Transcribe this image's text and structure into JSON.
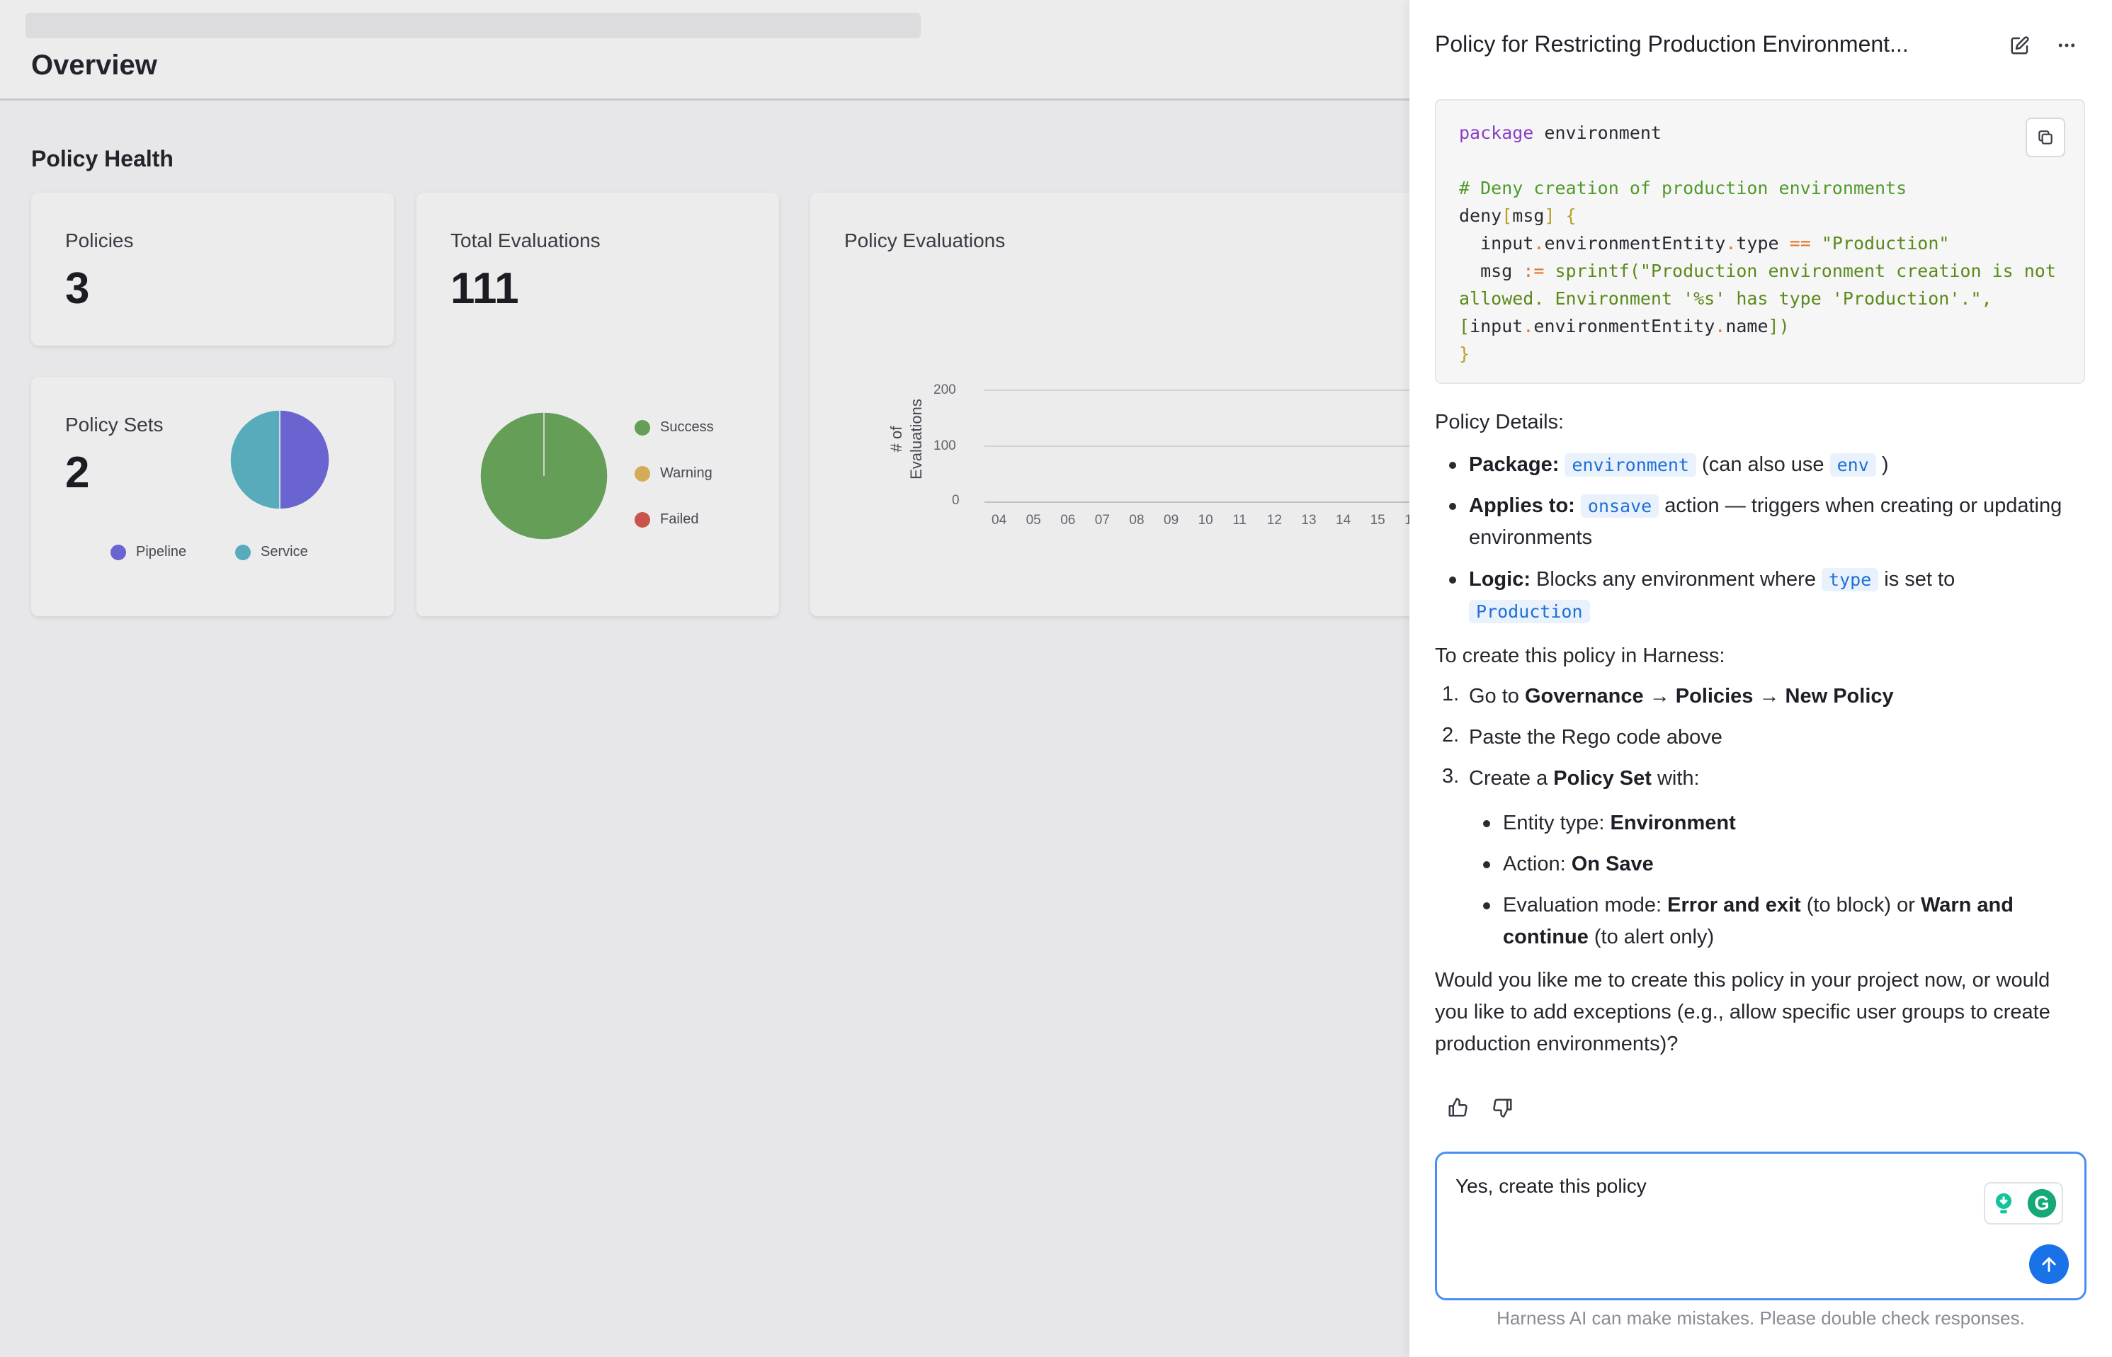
{
  "dashboard": {
    "title": "Overview",
    "section_title": "Policy Health",
    "policies": {
      "label": "Policies",
      "value": "3"
    },
    "policy_sets": {
      "label": "Policy Sets",
      "value": "2",
      "legend": [
        {
          "label": "Pipeline",
          "color": "#6f6ae0"
        },
        {
          "label": "Service",
          "color": "#5cb8c9"
        }
      ]
    },
    "total_evaluations": {
      "label": "Total Evaluations",
      "value": "111",
      "legend": [
        {
          "label": "Success",
          "color": "#6aaa5b"
        },
        {
          "label": "Warning",
          "color": "#e5b85a"
        },
        {
          "label": "Failed",
          "color": "#d9584e"
        }
      ]
    },
    "policy_evaluations": {
      "label": "Policy Evaluations",
      "y_axis_title_line1": "# of",
      "y_axis_title_line2": "Evaluations",
      "y_ticks": [
        "200",
        "100",
        "0"
      ],
      "x_ticks": [
        "04",
        "05",
        "06",
        "07",
        "08",
        "09",
        "10",
        "11",
        "12",
        "13",
        "14",
        "15",
        "1"
      ]
    }
  },
  "chart_data": [
    {
      "type": "pie",
      "title": "Policy Sets",
      "categories": [
        "Pipeline",
        "Service"
      ],
      "values": [
        1,
        1
      ],
      "colors": [
        "#6f6ae0",
        "#5cb8c9"
      ]
    },
    {
      "type": "pie",
      "title": "Total Evaluations",
      "categories": [
        "Success",
        "Warning",
        "Failed"
      ],
      "values": [
        111,
        0,
        0
      ],
      "colors": [
        "#6aaa5b",
        "#e5b85a",
        "#d9584e"
      ]
    }
  ],
  "panel": {
    "title": "Policy for Restricting Production Environment...",
    "icons": {
      "edit": "edit-icon",
      "more": "more-icon",
      "copy": "copy-icon",
      "thumbs_up": "thumbs-up-icon",
      "thumbs_down": "thumbs-down-icon",
      "send": "send-icon"
    },
    "code": {
      "kw_package": "package",
      "pkg_name": " environment",
      "comment": "# Deny creation of production environments",
      "deny": "deny",
      "lbr": "[",
      "msg": "msg",
      "rbr": "]",
      "lbrace": " {",
      "l3_indent": "  ",
      "l3_input": "input",
      "dot": ".",
      "l3_entity": "environmentEntity",
      "l3_type": "type",
      "eqeq": " == ",
      "l3_str": "\"Production\"",
      "l4_msg": "  msg ",
      "assign": ":= ",
      "sprintf": "sprintf(",
      "l4_str1": "\"Production environment creation is not",
      "l5_str2": "allowed. Environment '%s' has type 'Production'.\"",
      "comma": ",",
      "l6_lbr": "[",
      "l6_input": "input",
      "l6_entity": "environmentEntity",
      "l6_name": "name",
      "l6_close": "])",
      "rbrace": "}"
    },
    "details_heading": "Policy Details:",
    "details": [
      {
        "key": "Package:",
        "code1": "environment",
        "mid": " (can also use ",
        "code2": "env",
        "tail": " )"
      },
      {
        "key": "Applies to:",
        "code1": "onsave",
        "text_l1": " action — triggers when creating or updating",
        "text_l2": "environments"
      },
      {
        "key": "Logic:",
        "text1": " Blocks any environment where ",
        "code1": "type",
        "text2": " is set to",
        "code2": "Production"
      }
    ],
    "create_heading": "To create this policy in Harness:",
    "steps": {
      "s1_num": "1.",
      "s1_pre": "Go to ",
      "s1_b1": "Governance",
      "s1_arrow1": " → ",
      "s1_b2": "Policies",
      "s1_arrow2": " → ",
      "s1_b3": "New Policy",
      "s2_num": "2.",
      "s2_text": "Paste the Rego code above",
      "s3_num": "3.",
      "s3_pre": "Create a ",
      "s3_b": "Policy Set",
      "s3_post": " with:"
    },
    "sub_steps": {
      "entity_label": "Entity type: ",
      "entity_value": "Environment",
      "action_label": "Action: ",
      "action_value": "On Save",
      "mode_label": "Evaluation mode: ",
      "mode_b1": "Error and exit",
      "mode_mid": " (to block) or ",
      "mode_b2": "Warn and",
      "mode_b3": "continue",
      "mode_tail": " (to alert only)"
    },
    "closing_l1": "Would you like me to create this policy in your project now, or would",
    "closing_l2": "you like to add exceptions (e.g., allow specific user groups to create",
    "closing_l3": "production environments)?",
    "composer_value": "Yes, create this policy",
    "disclaimer": "Harness AI can make mistakes. Please double check responses."
  }
}
